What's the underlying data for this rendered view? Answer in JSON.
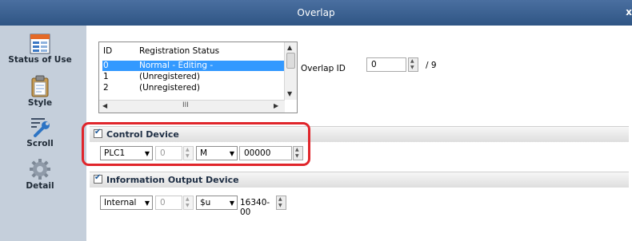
{
  "window": {
    "title": "Overlap",
    "close_glyph": "x"
  },
  "sidebar": {
    "items": [
      {
        "label": "Status of Use",
        "icon": "status-of-use-icon",
        "active": true
      },
      {
        "label": "Style",
        "icon": "style-clipboard-icon",
        "active": false
      },
      {
        "label": "Scroll",
        "icon": "scroll-wrench-icon",
        "active": false
      },
      {
        "label": "Detail",
        "icon": "detail-gear-icon",
        "active": false
      }
    ]
  },
  "registration_list": {
    "headers": [
      "ID",
      "Registration Status"
    ],
    "rows": [
      {
        "id": "0",
        "status": "Normal - Editing -",
        "selected": true
      },
      {
        "id": "1",
        "status": "(Unregistered)",
        "selected": false
      },
      {
        "id": "2",
        "status": "(Unregistered)",
        "selected": false
      }
    ],
    "hscroll_thumb_glyph": "III"
  },
  "overlap_id": {
    "label": "Overlap ID",
    "value": "0",
    "max_label": "/ 9"
  },
  "control_device": {
    "section_label": "Control Device",
    "checked": true,
    "connection": "PLC1",
    "port_value": "0",
    "device_type": "M",
    "address": "00000"
  },
  "info_output_device": {
    "section_label": "Information Output Device",
    "checked": true,
    "connection": "Internal",
    "port_value": "0",
    "device_type": "$u",
    "address": "16340-00"
  },
  "colors": {
    "highlight": "#e0252b",
    "selection": "#3399ff",
    "titlebar": "#3a6192"
  }
}
